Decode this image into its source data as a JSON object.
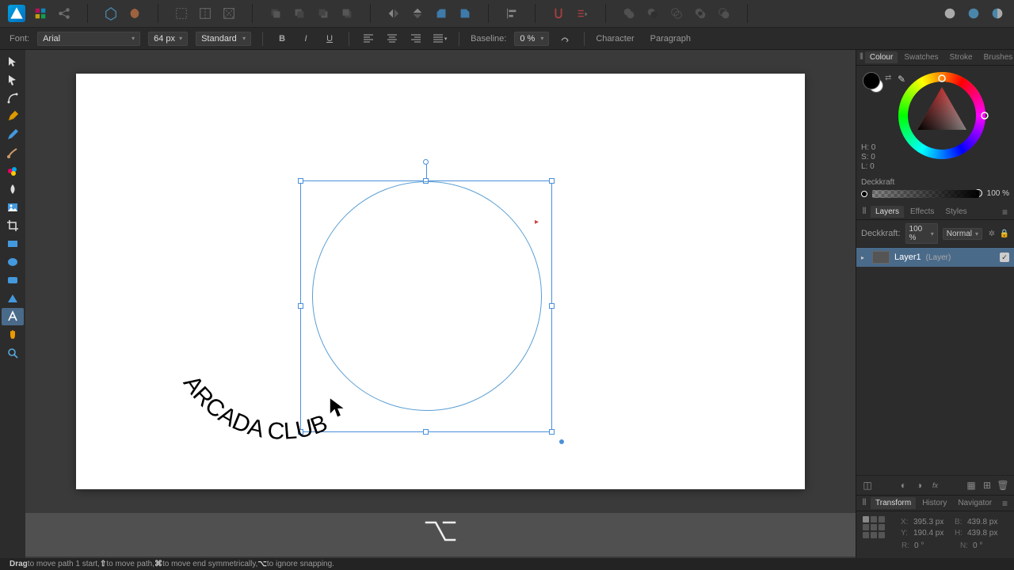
{
  "toolbar": {},
  "context": {
    "font_label": "Font:",
    "font_name": "Arial",
    "font_size": "64 px",
    "font_style": "Standard",
    "baseline_label": "Baseline:",
    "baseline_value": "0 %",
    "character": "Character",
    "paragraph": "Paragraph"
  },
  "canvas": {
    "curved_text": "ARCADA CLUB",
    "key_hint": "⌥"
  },
  "colour": {
    "tabs": [
      "Colour",
      "Swatches",
      "Stroke",
      "Brushes"
    ],
    "h": "H: 0",
    "s": "S: 0",
    "l": "L: 0",
    "opacity_label": "Deckkraft",
    "opacity_value": "100 %"
  },
  "layers": {
    "tabs": [
      "Layers",
      "Effects",
      "Styles"
    ],
    "opacity_label": "Deckkraft:",
    "opacity_value": "100 %",
    "blend_mode": "Normal",
    "layer_name": "Layer1",
    "layer_type": "(Layer)"
  },
  "transform": {
    "tabs": [
      "Transform",
      "History",
      "Navigator"
    ],
    "x_label": "X:",
    "x": "395.3 px",
    "y_label": "Y:",
    "y": "190.4 px",
    "w_label": "B:",
    "w": "439.8 px",
    "h_label": "H:",
    "h": "439.8 px",
    "r_label": "R:",
    "r": "0 °",
    "s_label": "N:",
    "s": "0 °"
  },
  "status": {
    "drag": "Drag",
    "msg1": " to move path 1 start, ",
    "k1": "⇧",
    "msg2": " to move path, ",
    "k2": "⌘",
    "msg3": " to move end symmetrically, ",
    "k3": "⌥",
    "msg4": " to ignore snapping."
  }
}
